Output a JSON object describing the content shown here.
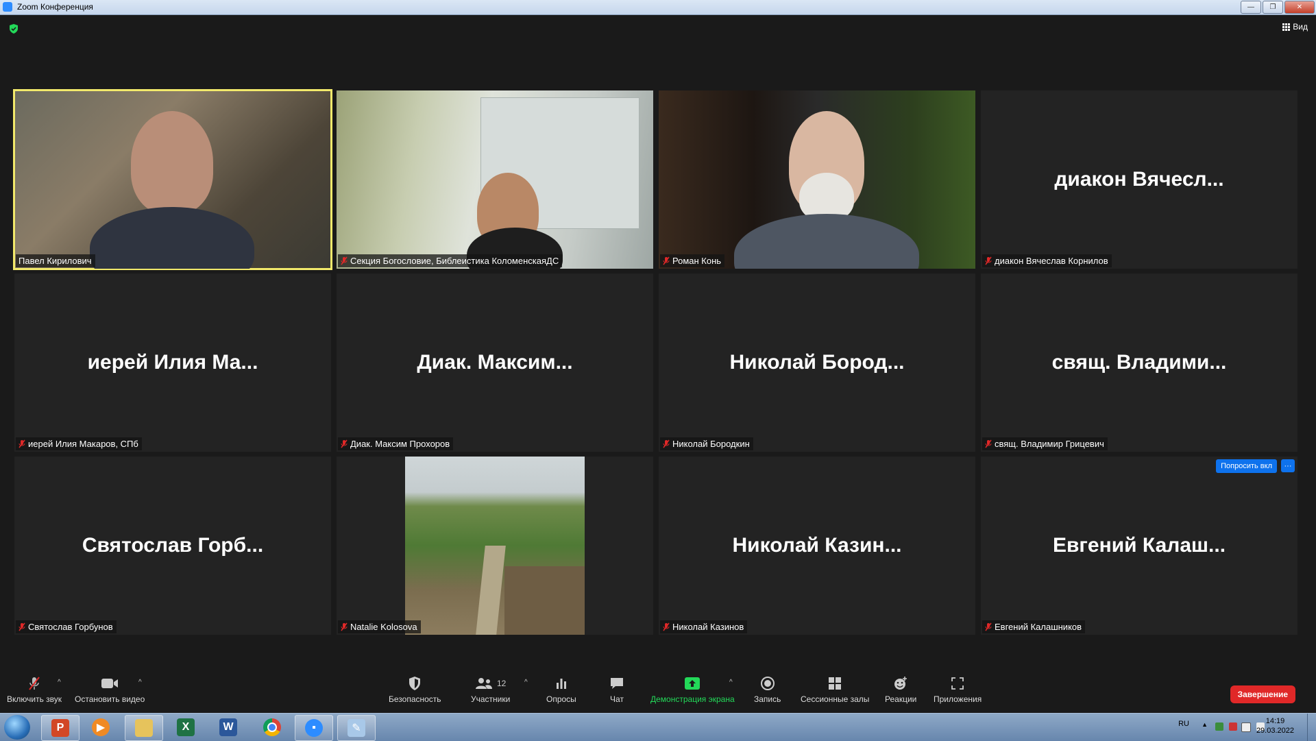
{
  "window": {
    "title": "Zoom Конференция"
  },
  "header": {
    "view_label": "Вид"
  },
  "tiles": [
    {
      "tag": "Павел Кирилович"
    },
    {
      "tag": "Секция Богословие, Библеистика КоломенскаяДС"
    },
    {
      "tag": "Роман Конь"
    },
    {
      "big": "диакон  Вячесл...",
      "tag": "диакон Вячеслав Корнилов"
    },
    {
      "big": "иерей  Илия  Ма...",
      "tag": "иерей Илия Макаров, СПб"
    },
    {
      "big": "Диак.  Максим...",
      "tag": "Диак. Максим Прохоров"
    },
    {
      "big": "Николай  Бород...",
      "tag": "Николай Бородкин"
    },
    {
      "big": "свящ.  Владими...",
      "tag": "свящ. Владимир Грицевич"
    },
    {
      "big": "Святослав  Горб...",
      "tag": "Святослав Горбунов"
    },
    {
      "tag": "Natalie Kolosova"
    },
    {
      "big": "Николай  Казин...",
      "tag": "Николай Казинов"
    },
    {
      "big": "Евгений  Калаш...",
      "tag": "Евгений Калашников",
      "ask": "Попросить вкл",
      "more": "···"
    }
  ],
  "toolbar": {
    "unmute": "Включить звук",
    "stop_video": "Остановить видео",
    "security": "Безопасность",
    "participants": "Участники",
    "participants_count": "12",
    "polls": "Опросы",
    "chat": "Чат",
    "share": "Демонстрация экрана",
    "record": "Запись",
    "breakout": "Сессионные залы",
    "reactions": "Реакции",
    "apps": "Приложения",
    "end": "Завершение"
  },
  "taskbar": {
    "apps": [
      "powerpoint-icon",
      "media-player-icon",
      "file-explorer-icon",
      "excel-icon",
      "word-icon",
      "chrome-icon",
      "zoom-icon",
      "paint-icon"
    ],
    "lang": "RU",
    "time": "14:19",
    "date": "29.03.2022"
  },
  "colors": {
    "active_speaker": "#f2e96b",
    "share_green": "#23d959",
    "end_red": "#e02828",
    "zoom_blue": "#0e72ed"
  }
}
